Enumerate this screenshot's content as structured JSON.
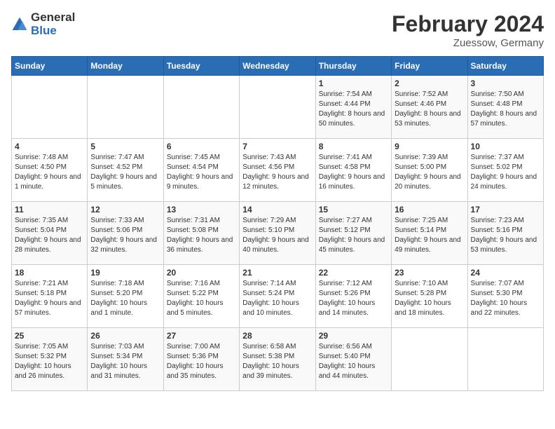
{
  "logo": {
    "general": "General",
    "blue": "Blue"
  },
  "title": "February 2024",
  "subtitle": "Zuessow, Germany",
  "weekdays": [
    "Sunday",
    "Monday",
    "Tuesday",
    "Wednesday",
    "Thursday",
    "Friday",
    "Saturday"
  ],
  "weeks": [
    [
      {
        "day": "",
        "sunrise": "",
        "sunset": "",
        "daylight": ""
      },
      {
        "day": "",
        "sunrise": "",
        "sunset": "",
        "daylight": ""
      },
      {
        "day": "",
        "sunrise": "",
        "sunset": "",
        "daylight": ""
      },
      {
        "day": "",
        "sunrise": "",
        "sunset": "",
        "daylight": ""
      },
      {
        "day": "1",
        "sunrise": "Sunrise: 7:54 AM",
        "sunset": "Sunset: 4:44 PM",
        "daylight": "Daylight: 8 hours and 50 minutes."
      },
      {
        "day": "2",
        "sunrise": "Sunrise: 7:52 AM",
        "sunset": "Sunset: 4:46 PM",
        "daylight": "Daylight: 8 hours and 53 minutes."
      },
      {
        "day": "3",
        "sunrise": "Sunrise: 7:50 AM",
        "sunset": "Sunset: 4:48 PM",
        "daylight": "Daylight: 8 hours and 57 minutes."
      }
    ],
    [
      {
        "day": "4",
        "sunrise": "Sunrise: 7:48 AM",
        "sunset": "Sunset: 4:50 PM",
        "daylight": "Daylight: 9 hours and 1 minute."
      },
      {
        "day": "5",
        "sunrise": "Sunrise: 7:47 AM",
        "sunset": "Sunset: 4:52 PM",
        "daylight": "Daylight: 9 hours and 5 minutes."
      },
      {
        "day": "6",
        "sunrise": "Sunrise: 7:45 AM",
        "sunset": "Sunset: 4:54 PM",
        "daylight": "Daylight: 9 hours and 9 minutes."
      },
      {
        "day": "7",
        "sunrise": "Sunrise: 7:43 AM",
        "sunset": "Sunset: 4:56 PM",
        "daylight": "Daylight: 9 hours and 12 minutes."
      },
      {
        "day": "8",
        "sunrise": "Sunrise: 7:41 AM",
        "sunset": "Sunset: 4:58 PM",
        "daylight": "Daylight: 9 hours and 16 minutes."
      },
      {
        "day": "9",
        "sunrise": "Sunrise: 7:39 AM",
        "sunset": "Sunset: 5:00 PM",
        "daylight": "Daylight: 9 hours and 20 minutes."
      },
      {
        "day": "10",
        "sunrise": "Sunrise: 7:37 AM",
        "sunset": "Sunset: 5:02 PM",
        "daylight": "Daylight: 9 hours and 24 minutes."
      }
    ],
    [
      {
        "day": "11",
        "sunrise": "Sunrise: 7:35 AM",
        "sunset": "Sunset: 5:04 PM",
        "daylight": "Daylight: 9 hours and 28 minutes."
      },
      {
        "day": "12",
        "sunrise": "Sunrise: 7:33 AM",
        "sunset": "Sunset: 5:06 PM",
        "daylight": "Daylight: 9 hours and 32 minutes."
      },
      {
        "day": "13",
        "sunrise": "Sunrise: 7:31 AM",
        "sunset": "Sunset: 5:08 PM",
        "daylight": "Daylight: 9 hours and 36 minutes."
      },
      {
        "day": "14",
        "sunrise": "Sunrise: 7:29 AM",
        "sunset": "Sunset: 5:10 PM",
        "daylight": "Daylight: 9 hours and 40 minutes."
      },
      {
        "day": "15",
        "sunrise": "Sunrise: 7:27 AM",
        "sunset": "Sunset: 5:12 PM",
        "daylight": "Daylight: 9 hours and 45 minutes."
      },
      {
        "day": "16",
        "sunrise": "Sunrise: 7:25 AM",
        "sunset": "Sunset: 5:14 PM",
        "daylight": "Daylight: 9 hours and 49 minutes."
      },
      {
        "day": "17",
        "sunrise": "Sunrise: 7:23 AM",
        "sunset": "Sunset: 5:16 PM",
        "daylight": "Daylight: 9 hours and 53 minutes."
      }
    ],
    [
      {
        "day": "18",
        "sunrise": "Sunrise: 7:21 AM",
        "sunset": "Sunset: 5:18 PM",
        "daylight": "Daylight: 9 hours and 57 minutes."
      },
      {
        "day": "19",
        "sunrise": "Sunrise: 7:18 AM",
        "sunset": "Sunset: 5:20 PM",
        "daylight": "Daylight: 10 hours and 1 minute."
      },
      {
        "day": "20",
        "sunrise": "Sunrise: 7:16 AM",
        "sunset": "Sunset: 5:22 PM",
        "daylight": "Daylight: 10 hours and 5 minutes."
      },
      {
        "day": "21",
        "sunrise": "Sunrise: 7:14 AM",
        "sunset": "Sunset: 5:24 PM",
        "daylight": "Daylight: 10 hours and 10 minutes."
      },
      {
        "day": "22",
        "sunrise": "Sunrise: 7:12 AM",
        "sunset": "Sunset: 5:26 PM",
        "daylight": "Daylight: 10 hours and 14 minutes."
      },
      {
        "day": "23",
        "sunrise": "Sunrise: 7:10 AM",
        "sunset": "Sunset: 5:28 PM",
        "daylight": "Daylight: 10 hours and 18 minutes."
      },
      {
        "day": "24",
        "sunrise": "Sunrise: 7:07 AM",
        "sunset": "Sunset: 5:30 PM",
        "daylight": "Daylight: 10 hours and 22 minutes."
      }
    ],
    [
      {
        "day": "25",
        "sunrise": "Sunrise: 7:05 AM",
        "sunset": "Sunset: 5:32 PM",
        "daylight": "Daylight: 10 hours and 26 minutes."
      },
      {
        "day": "26",
        "sunrise": "Sunrise: 7:03 AM",
        "sunset": "Sunset: 5:34 PM",
        "daylight": "Daylight: 10 hours and 31 minutes."
      },
      {
        "day": "27",
        "sunrise": "Sunrise: 7:00 AM",
        "sunset": "Sunset: 5:36 PM",
        "daylight": "Daylight: 10 hours and 35 minutes."
      },
      {
        "day": "28",
        "sunrise": "Sunrise: 6:58 AM",
        "sunset": "Sunset: 5:38 PM",
        "daylight": "Daylight: 10 hours and 39 minutes."
      },
      {
        "day": "29",
        "sunrise": "Sunrise: 6:56 AM",
        "sunset": "Sunset: 5:40 PM",
        "daylight": "Daylight: 10 hours and 44 minutes."
      },
      {
        "day": "",
        "sunrise": "",
        "sunset": "",
        "daylight": ""
      },
      {
        "day": "",
        "sunrise": "",
        "sunset": "",
        "daylight": ""
      }
    ]
  ]
}
